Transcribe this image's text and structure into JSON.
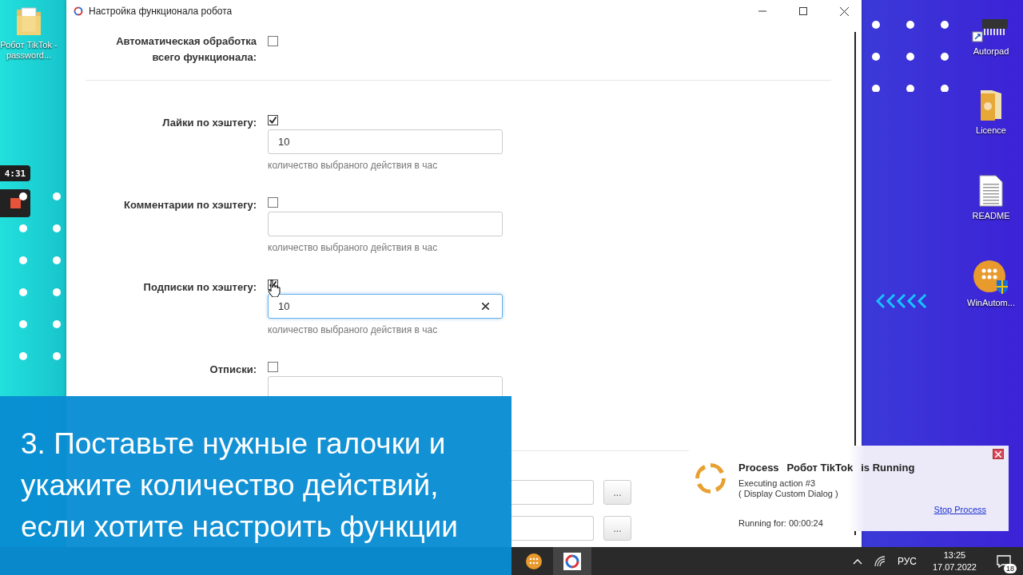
{
  "desktop": {
    "left_icons": [
      {
        "label": "Робот TikTok - password...",
        "kind": "folder"
      }
    ],
    "recorder": {
      "time": "4:31"
    },
    "right_icons": [
      {
        "label": "Autorpad",
        "kind": "chip"
      },
      {
        "label": "Licence",
        "kind": "folder"
      },
      {
        "label": "README",
        "kind": "document"
      },
      {
        "label": "WinAutom...",
        "kind": "app"
      }
    ]
  },
  "window": {
    "title": "Настройка функционала робота",
    "rows": [
      {
        "kind": "toggle",
        "label": "Автоматическая обработка всего функционала:",
        "checked": false
      },
      {
        "kind": "counter",
        "label": "Лайки по хэштегу:",
        "checked": true,
        "value": "10",
        "hint": "количество выбраного действия в час",
        "focused": false
      },
      {
        "kind": "counter",
        "label": "Комментарии по хэштегу:",
        "checked": false,
        "hint": "количество выбраного действия в час",
        "focused": false
      },
      {
        "kind": "counter",
        "label": "Подписки по хэштегу:",
        "checked": true,
        "value": "10",
        "hint": "количество выбраного действия в час",
        "focused": true
      },
      {
        "kind": "counter",
        "label": "Отписки:",
        "checked": false,
        "focused": false
      },
      {
        "kind": "file",
        "button": "..."
      },
      {
        "kind": "file",
        "button": "..."
      }
    ]
  },
  "notification": {
    "process": "Process",
    "name": "Робот TikTok",
    "status": "is Running",
    "action": "Executing action #3",
    "detail": "( Display Custom Dialog )",
    "elapsed": "Running for: 00:00:24",
    "stop": "Stop Process"
  },
  "caption": "3. Поставьте нужные галочки и укажите количество действий, если хотите настроить функции",
  "taskbar": {
    "language": "РУС",
    "time": "13:25",
    "date": "17.07.2022",
    "notifications": "18"
  }
}
